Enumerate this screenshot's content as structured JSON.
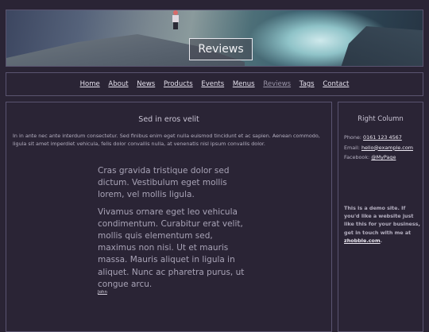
{
  "hero": {
    "title": "Reviews"
  },
  "nav": {
    "items": [
      {
        "label": "Home"
      },
      {
        "label": "About"
      },
      {
        "label": "News"
      },
      {
        "label": "Products"
      },
      {
        "label": "Events"
      },
      {
        "label": "Menus"
      },
      {
        "label": "Reviews",
        "active": true
      },
      {
        "label": "Tags"
      },
      {
        "label": "Contact"
      }
    ]
  },
  "main": {
    "title": "Sed in eros velit",
    "intro": "In in ante nec ante interdum consectetur. Sed finibus enim eget nulla euismod tincidunt et ac sapien. Aenean commodo, ligula sit amet imperdiet vehicula, felis dolor convallis nulla, at venenatis nisl ipsum convallis dolor.",
    "quote_p1": "Cras gravida tristique dolor sed dictum. Vestibulum eget mollis lorem, vel mollis ligula.",
    "quote_p2": "Vivamus ornare eget leo vehicula condimentum. Curabitur erat velit, mollis quis elementum sed, maximus non nisi. Ut et mauris massa. Mauris aliquet in ligula in aliquet. Nunc ac pharetra purus, ut congue arcu.",
    "citation": "John"
  },
  "sidebar": {
    "title": "Right Column",
    "phone_label": "Phone:",
    "phone": "0161 123 4567",
    "email_label": "Email:",
    "email": "hello@example.com",
    "facebook_label": "Facebook:",
    "facebook": "@MyPage",
    "demo_text": "This is a demo site. If you'd like a website just like this for your business, get in touch with me at",
    "demo_link": "zhobble.com",
    "demo_end": "."
  }
}
